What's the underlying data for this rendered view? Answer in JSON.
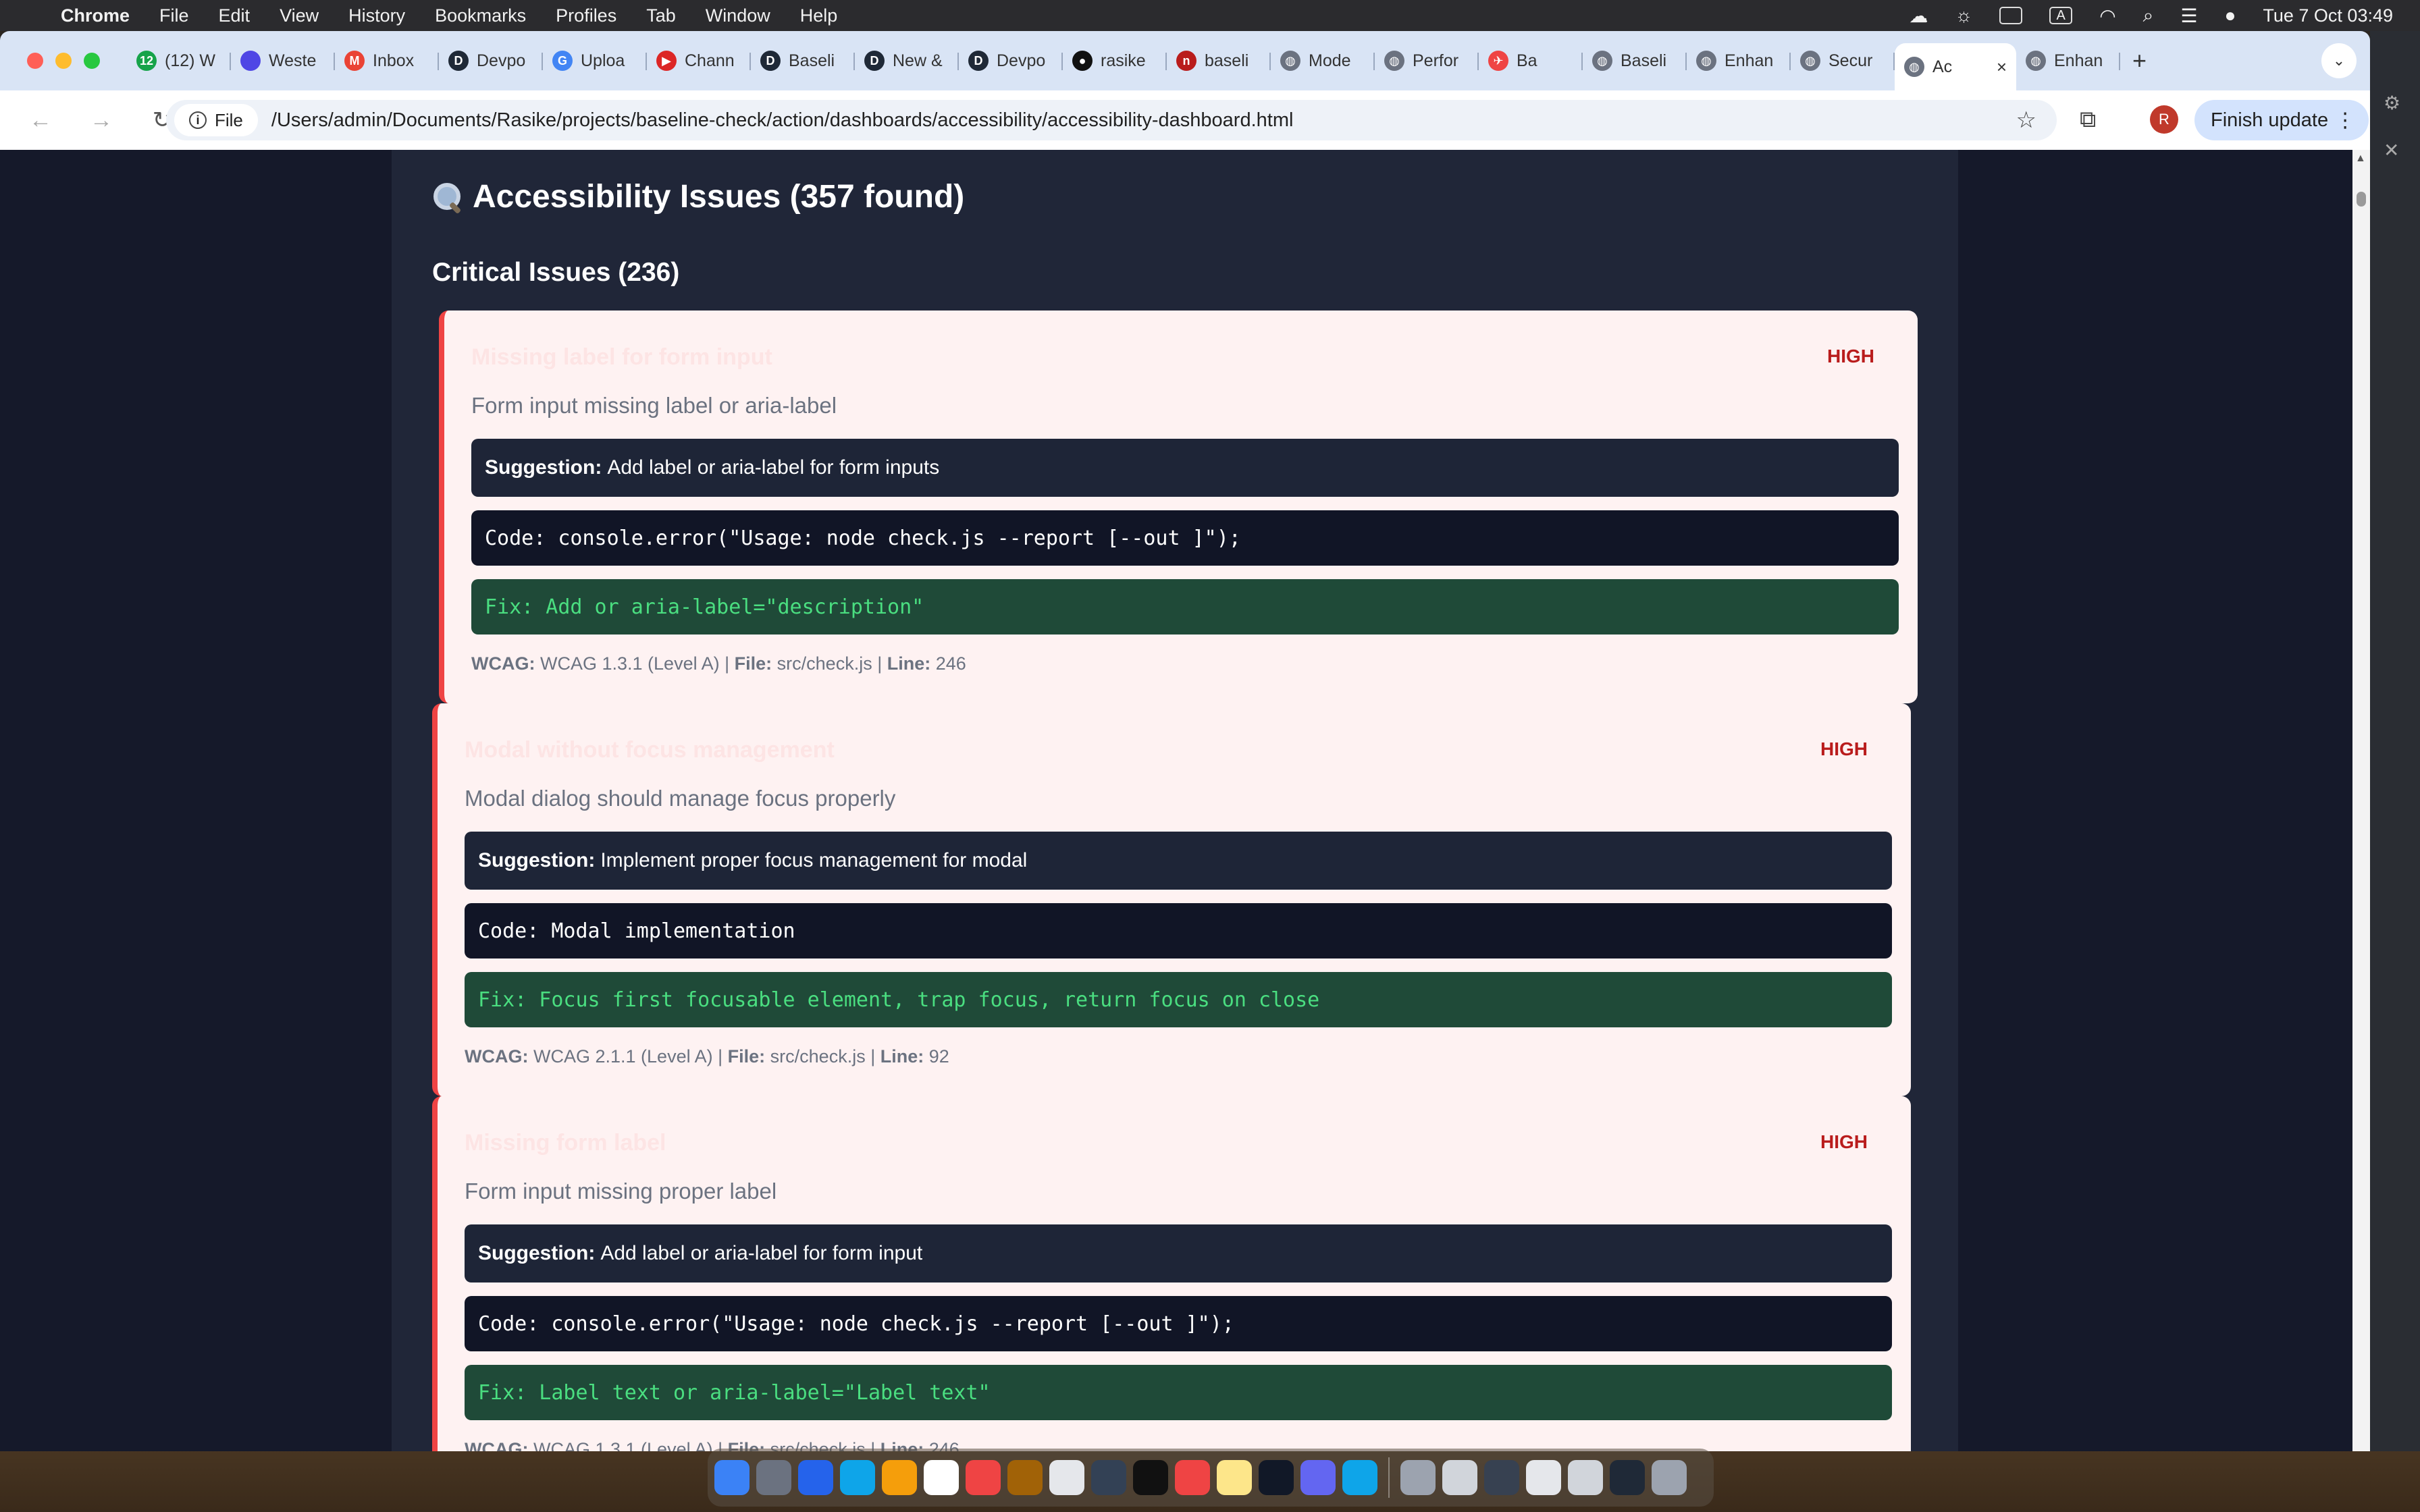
{
  "menubar": {
    "app": "Chrome",
    "items": [
      "File",
      "Edit",
      "View",
      "History",
      "Bookmarks",
      "Profiles",
      "Tab",
      "Window",
      "Help"
    ],
    "datetime": "Tue 7 Oct  03:49",
    "input_badge": "A"
  },
  "tabs": [
    {
      "label": "(12) W",
      "fav_color": "#16a34a",
      "fav_text": "12"
    },
    {
      "label": "Weste",
      "fav_color": "#4f46e5",
      "fav_text": ""
    },
    {
      "label": "Inbox",
      "fav_color": "#ea4335",
      "fav_text": "M"
    },
    {
      "label": "Devpo",
      "fav_color": "#1f2937",
      "fav_text": "D"
    },
    {
      "label": "Uploa",
      "fav_color": "#4285f4",
      "fav_text": "G"
    },
    {
      "label": "Chann",
      "fav_color": "#dc2626",
      "fav_text": "▶"
    },
    {
      "label": "Baseli",
      "fav_color": "#1f2937",
      "fav_text": "D"
    },
    {
      "label": "New &",
      "fav_color": "#1f2937",
      "fav_text": "D"
    },
    {
      "label": "Devpo",
      "fav_color": "#1f2937",
      "fav_text": "D"
    },
    {
      "label": "rasike",
      "fav_color": "#111111",
      "fav_text": "●"
    },
    {
      "label": "baseli",
      "fav_color": "#b91c1c",
      "fav_text": "n"
    },
    {
      "label": "Mode",
      "fav_color": "#6b7280",
      "fav_text": "◍"
    },
    {
      "label": "Perfor",
      "fav_color": "#6b7280",
      "fav_text": "◍"
    },
    {
      "label": "Ba",
      "fav_color": "#ef4444",
      "fav_text": "✈"
    },
    {
      "label": "Baseli",
      "fav_color": "#6b7280",
      "fav_text": "◍"
    },
    {
      "label": "Enhan",
      "fav_color": "#6b7280",
      "fav_text": "◍"
    },
    {
      "label": "Secur",
      "fav_color": "#6b7280",
      "fav_text": "◍"
    },
    {
      "label": "Ac",
      "fav_color": "#6b7280",
      "fav_text": "◍",
      "active": true
    },
    {
      "label": "Enhan",
      "fav_color": "#6b7280",
      "fav_text": "◍"
    }
  ],
  "toolbar": {
    "chip_label": "File",
    "url": "/Users/admin/Documents/Rasike/projects/baseline-check/action/dashboards/accessibility/accessibility-dashboard.html",
    "avatar_letter": "R",
    "finish_update": "Finish update"
  },
  "page": {
    "section_title": "Accessibility Issues (357 found)",
    "critical_title": "Critical Issues (236)",
    "issues": [
      {
        "title": "Missing label for form input",
        "severity": "HIGH",
        "description": "Form input missing label or aria-label",
        "suggestion_label": "Suggestion:",
        "suggestion": "Add label or aria-label for form inputs",
        "code": "Code: console.error(\"Usage: node check.js --report [--out ]\");",
        "fix": "Fix: Add or aria-label=\"description\"",
        "wcag_label": "WCAG:",
        "wcag": "WCAG 1.3.1 (Level A)",
        "file_label": "File:",
        "file": "src/check.js",
        "line_label": "Line:",
        "line": "246"
      },
      {
        "title": "Modal without focus management",
        "severity": "HIGH",
        "description": "Modal dialog should manage focus properly",
        "suggestion_label": "Suggestion:",
        "suggestion": "Implement proper focus management for modal",
        "code": "Code: Modal implementation",
        "fix": "Fix: Focus first focusable element, trap focus, return focus on close",
        "wcag_label": "WCAG:",
        "wcag": "WCAG 2.1.1 (Level A)",
        "file_label": "File:",
        "file": "src/check.js",
        "line_label": "Line:",
        "line": "92"
      },
      {
        "title": "Missing form label",
        "severity": "HIGH",
        "description": "Form input missing proper label",
        "suggestion_label": "Suggestion:",
        "suggestion": "Add label or aria-label for form input",
        "code": "Code: console.error(\"Usage: node check.js --report [--out ]\");",
        "fix": "Fix: Label text or aria-label=\"Label text\"",
        "wcag_label": "WCAG:",
        "wcag": "WCAG 1.3.1 (Level A)",
        "file_label": "File:",
        "file": "src/check.js",
        "line_label": "Line:",
        "line": "246"
      }
    ]
  },
  "colors": {
    "severity_high": "#b91c1c",
    "card_bg": "#fef2f2",
    "card_border": "#ef4444",
    "fix_text": "#4ade80"
  }
}
